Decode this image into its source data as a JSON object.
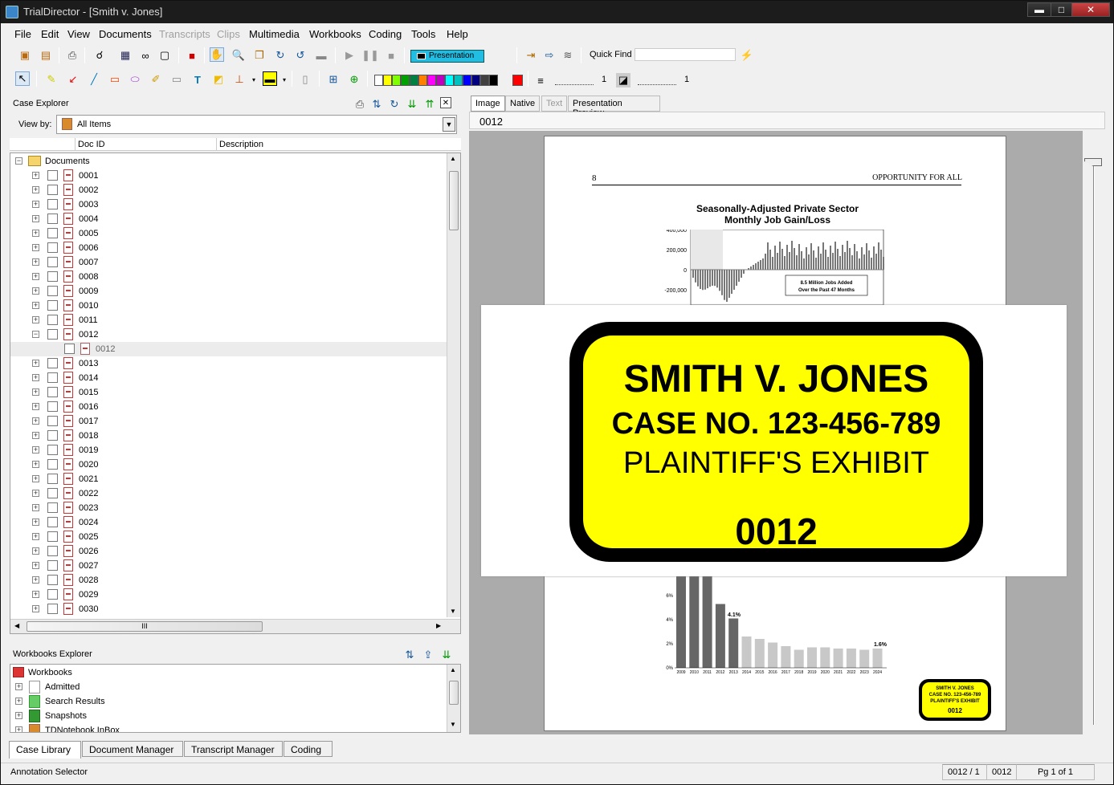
{
  "window": {
    "title": "TrialDirector - [Smith v. Jones]",
    "minimize": "▬",
    "maximize": "□",
    "close": "✕"
  },
  "menu": [
    {
      "label": "File",
      "enabled": true
    },
    {
      "label": "Edit",
      "enabled": true
    },
    {
      "label": "View",
      "enabled": true
    },
    {
      "label": "Documents",
      "enabled": true
    },
    {
      "label": "Transcripts",
      "enabled": false
    },
    {
      "label": "Clips",
      "enabled": false
    },
    {
      "label": "Multimedia",
      "enabled": true
    },
    {
      "label": "Workbooks",
      "enabled": true
    },
    {
      "label": "Coding",
      "enabled": true
    },
    {
      "label": "Tools",
      "enabled": true
    },
    {
      "label": "Help",
      "enabled": true
    }
  ],
  "toolbar": {
    "presentation_label": "Presentation",
    "quick_find_label": "Quick Find",
    "quick_find_value": "",
    "line_width_1": "1",
    "line_width_2": "1",
    "colors": [
      "#ffffff",
      "#ffff00",
      "#80ff00",
      "#00a000",
      "#008040",
      "#ff8000",
      "#ff00ff",
      "#c000c0",
      "#00ffff",
      "#00c0c0",
      "#0000ff",
      "#000080",
      "#404040",
      "#000000"
    ],
    "current_color": "#ff0000"
  },
  "case_explorer": {
    "title": "Case Explorer",
    "view_by_label": "View by:",
    "view_by_value": "All Items",
    "columns": [
      "Doc ID",
      "Description"
    ],
    "root": "Documents",
    "docs": [
      "0001",
      "0002",
      "0003",
      "0004",
      "0005",
      "0006",
      "0007",
      "0008",
      "0009",
      "0010",
      "0011",
      "0012"
    ],
    "selected_child": "0012",
    "docs_after": [
      "0013",
      "0014",
      "0015",
      "0016",
      "0017",
      "0018",
      "0019",
      "0020",
      "0021",
      "0022",
      "0023",
      "0024",
      "0025",
      "0026",
      "0027",
      "0028",
      "0029",
      "0030"
    ],
    "hscroll_grip": "III"
  },
  "workbooks_explorer": {
    "title": "Workbooks Explorer",
    "root": "Workbooks",
    "items": [
      "Admitted",
      "Search Results",
      "Snapshots",
      "TDNotebook InBox"
    ]
  },
  "bottom_tabs": [
    "Case Library",
    "Document Manager",
    "Transcript Manager",
    "Coding"
  ],
  "viewer": {
    "tabs": [
      "Image",
      "Native",
      "Text",
      "Presentation Preview"
    ],
    "doc_id": "0012",
    "page_header_left": "8",
    "page_header_right": "OPPORTUNITY FOR ALL",
    "chart_title_1": "Seasonally-Adjusted Private Sector",
    "chart_title_2": "Monthly Job Gain/Loss",
    "chart_y_labels": [
      "400,000",
      "200,000",
      "0",
      "-200,000"
    ],
    "chart_callout_1": "8.5 Million Jobs Added",
    "chart_callout_2": "Over the Past 47 Months",
    "bar_labels": [
      "6%",
      "4%",
      "2%",
      "0%"
    ],
    "bar_years": [
      "2009",
      "2010",
      "2011",
      "2012",
      "2013",
      "2014",
      "2015",
      "2016",
      "2017",
      "2018",
      "2019",
      "2020",
      "2021",
      "2022",
      "2023",
      "2024"
    ],
    "bar_note_1": "4.1%",
    "bar_note_2": "1.6%"
  },
  "exhibit": {
    "line1": "SMITH V. JONES",
    "line2": "CASE NO. 123-456-789",
    "line3": "PLAINTIFF'S EXHIBIT",
    "number": "0012"
  },
  "status": {
    "left": "Annotation Selector",
    "doc_page": "0012 / 1",
    "doc": "0012",
    "pages": "Pg 1 of 1"
  }
}
